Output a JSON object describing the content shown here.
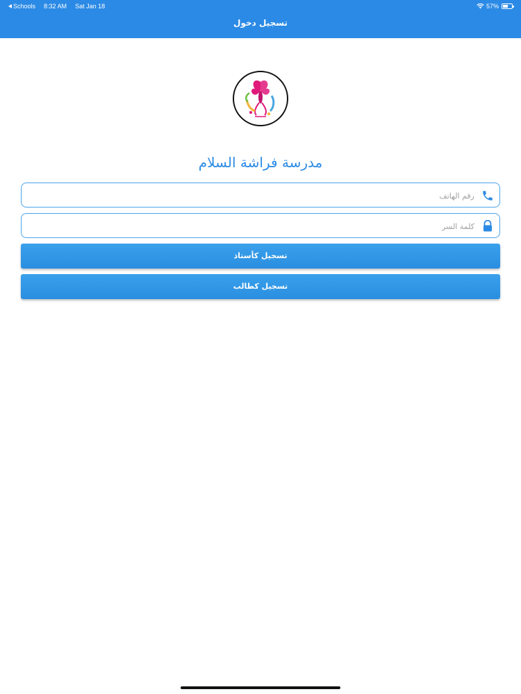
{
  "status_bar": {
    "back_app": "Schools",
    "time": "8:32 AM",
    "date": "Sat Jan 18",
    "battery_percent": "57%",
    "battery_level": 0.57,
    "icons": [
      "back-arrow-icon",
      "wifi-icon",
      "battery-icon"
    ]
  },
  "header": {
    "title": "تسجيل دخول",
    "color": "#2b8ae5"
  },
  "logo": {
    "alt_icon": "butterfly-logo-icon"
  },
  "school": {
    "name": "مدرسة فراشة السلام",
    "color": "#2b8ae5"
  },
  "form": {
    "phone": {
      "placeholder": "رقم الهاتف",
      "value": "",
      "icon": "phone-icon"
    },
    "password": {
      "placeholder": "كلمة السر",
      "value": "",
      "icon": "lock-icon"
    }
  },
  "buttons": {
    "teacher_login": "تسجيل كأستاذ",
    "student_login": "تسجيل كطالب"
  },
  "colors": {
    "accent": "#2b8ae5",
    "field_border": "#4aa3ea",
    "placeholder": "#a0a0a0"
  }
}
